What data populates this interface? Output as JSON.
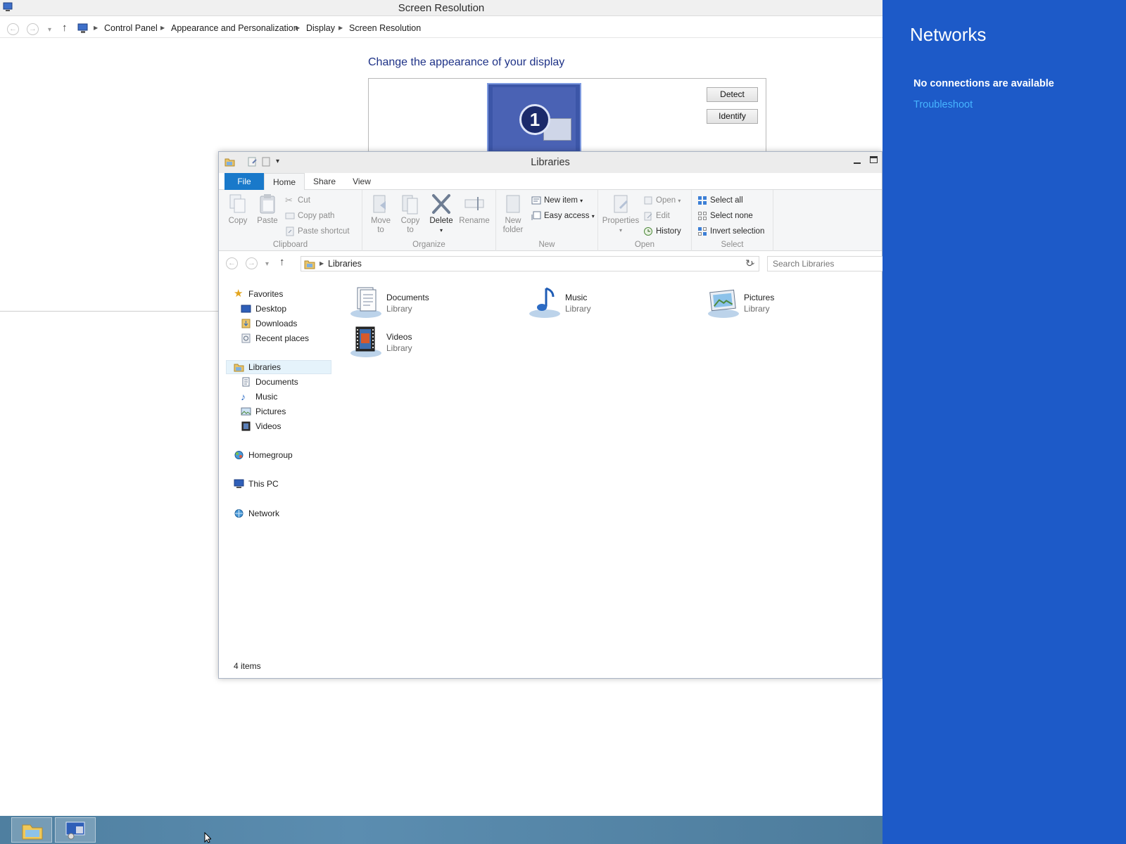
{
  "control_panel": {
    "title": "Screen Resolution",
    "breadcrumb": [
      "Control Panel",
      "Appearance and Personalization",
      "Display",
      "Screen Resolution"
    ],
    "heading": "Change the appearance of your display",
    "monitor_number": "1",
    "detect_label": "Detect",
    "identify_label": "Identify"
  },
  "explorer": {
    "title": "Libraries",
    "tabs": {
      "file": "File",
      "home": "Home",
      "share": "Share",
      "view": "View"
    },
    "ribbon": {
      "clipboard": {
        "label": "Clipboard",
        "copy": "Copy",
        "paste": "Paste",
        "cut": "Cut",
        "copy_path": "Copy path",
        "paste_shortcut": "Paste shortcut"
      },
      "organize": {
        "label": "Organize",
        "move_to_1": "Move",
        "move_to_2": "to",
        "copy_to_1": "Copy",
        "copy_to_2": "to",
        "delete": "Delete",
        "rename": "Rename"
      },
      "new": {
        "label": "New",
        "new_folder_1": "New",
        "new_folder_2": "folder",
        "new_item": "New item",
        "easy_access": "Easy access"
      },
      "open": {
        "label": "Open",
        "properties": "Properties",
        "open": "Open",
        "edit": "Edit",
        "history": "History"
      },
      "select": {
        "label": "Select",
        "select_all": "Select all",
        "select_none": "Select none",
        "invert_selection": "Invert selection"
      }
    },
    "address": "Libraries",
    "search_placeholder": "Search Libraries",
    "nav": {
      "favorites": "Favorites",
      "desktop": "Desktop",
      "downloads": "Downloads",
      "recent_places": "Recent places",
      "libraries": "Libraries",
      "documents": "Documents",
      "music": "Music",
      "pictures": "Pictures",
      "videos": "Videos",
      "homegroup": "Homegroup",
      "this_pc": "This PC",
      "network": "Network"
    },
    "libraries": [
      {
        "name": "Documents",
        "type": "Library"
      },
      {
        "name": "Music",
        "type": "Library"
      },
      {
        "name": "Pictures",
        "type": "Library"
      },
      {
        "name": "Videos",
        "type": "Library"
      }
    ],
    "status": "4 items"
  },
  "networks": {
    "title": "Networks",
    "message": "No connections are available",
    "troubleshoot": "Troubleshoot"
  },
  "colors": {
    "charm_bg": "#1d5ac8",
    "link": "#46b4ff",
    "file_tab": "#1979ca",
    "heading": "#1e3287"
  }
}
